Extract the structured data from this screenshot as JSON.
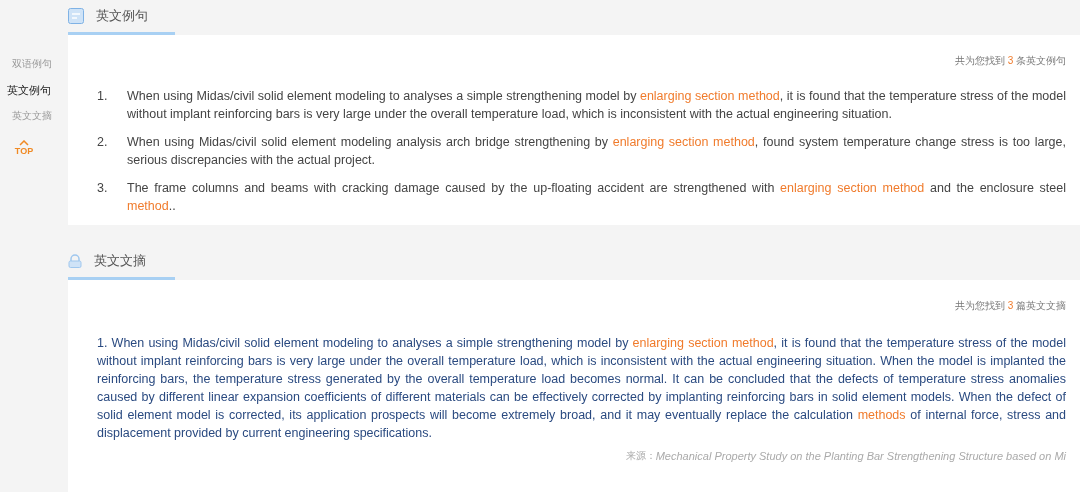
{
  "sidebar": {
    "items": [
      {
        "label": "双语例句",
        "selected": false
      },
      {
        "label": "英文例句",
        "selected": true
      },
      {
        "label": "英文文摘",
        "selected": false
      }
    ],
    "top_button": "TOP"
  },
  "sections": [
    {
      "kind": "sentences",
      "title": "英文例句",
      "count": {
        "before": "共为您找到",
        "number": "3",
        "after": "条英文例句"
      },
      "items": [
        {
          "number": "1.",
          "segments": [
            {
              "text": "When using Midas/civil solid element modeling to analyses a simple strengthening model by ",
              "highlight": false
            },
            {
              "text": "enlarging section method",
              "highlight": true
            },
            {
              "text": ", it is found that the temperature stress of the model without implant reinforcing bars is very large under the overall temperature load, which is inconsistent with the actual engineering situation.",
              "highlight": false
            }
          ]
        },
        {
          "number": "2.",
          "segments": [
            {
              "text": "When using Midas/civil solid element modeling analysis arch bridge strengthening by ",
              "highlight": false
            },
            {
              "text": "enlarging section method",
              "highlight": true
            },
            {
              "text": ", found system temperature change stress is too large, serious discrepancies with the actual project.",
              "highlight": false
            }
          ]
        },
        {
          "number": "3.",
          "segments": [
            {
              "text": "The frame columns and beams with cracking damage caused by the up-floating accident are strengthened with ",
              "highlight": false
            },
            {
              "text": "enlarging section method",
              "highlight": true
            },
            {
              "text": " and the enclosure steel ",
              "highlight": false
            },
            {
              "text": "method",
              "highlight": true
            },
            {
              "text": "..",
              "highlight": false
            }
          ]
        }
      ]
    },
    {
      "kind": "abstracts",
      "title": "英文文摘",
      "count": {
        "before": "共为您找到",
        "number": "3",
        "after": "篇英文文摘"
      },
      "items": [
        {
          "number": "1.",
          "segments": [
            {
              "text": "When using Midas/civil solid element modeling to analyses a simple strengthening model by ",
              "highlight": false
            },
            {
              "text": "enlarging section method",
              "highlight": true
            },
            {
              "text": ", it is found that the temperature stress of the model without implant reinforcing bars is very large under the overall temperature load, which is inconsistent with the actual engineering situation. When the model is implanted the reinforcing bars, the temperature stress generated by the overall temperature load becomes normal. It can be concluded that the defects of temperature stress anomalies caused by different linear expansion coefficients of different materials can be effectively corrected by implanting reinforcing bars in solid element models. When the defect of solid element model is corrected, its application prospects will become extremely broad, and it may eventually replace the calculation ",
              "highlight": false
            },
            {
              "text": "methods",
              "highlight": true
            },
            {
              "text": " of internal force, stress and displacement provided by current engineering specifications.",
              "highlight": false
            }
          ],
          "source_label": "来源：",
          "source": "Mechanical Property Study on the Planting Bar Strengthening Structure based on Mi"
        }
      ]
    }
  ]
}
